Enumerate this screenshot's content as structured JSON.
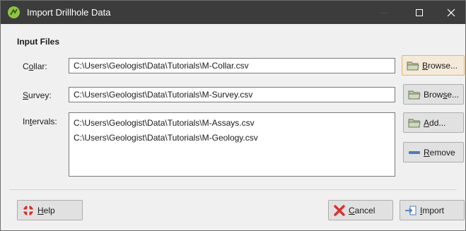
{
  "window": {
    "title": "Import Drillhole Data",
    "controls": {
      "minimize": "—",
      "maximize": "☐",
      "close": "✕"
    }
  },
  "input_files": {
    "section_label": "Input Files",
    "collar": {
      "label_pre": "C",
      "label_key": "o",
      "label_post": "llar:",
      "value": "C:\\Users\\Geologist\\Data\\Tutorials\\M-Collar.csv",
      "browse_pre": "",
      "browse_key": "B",
      "browse_post": "rowse..."
    },
    "survey": {
      "label_pre": "",
      "label_key": "S",
      "label_post": "urvey:",
      "value": "C:\\Users\\Geologist\\Data\\Tutorials\\M-Survey.csv",
      "browse_pre": "Brow",
      "browse_key": "s",
      "browse_post": "e..."
    },
    "intervals": {
      "label_pre": "In",
      "label_key": "t",
      "label_post": "ervals:",
      "items": [
        "C:\\Users\\Geologist\\Data\\Tutorials\\M-Assays.csv",
        "C:\\Users\\Geologist\\Data\\Tutorials\\M-Geology.csv"
      ],
      "add_pre": "",
      "add_key": "A",
      "add_post": "dd...",
      "remove_pre": "",
      "remove_key": "R",
      "remove_post": "emove"
    }
  },
  "footer": {
    "help_pre": "",
    "help_key": "H",
    "help_post": "elp",
    "cancel_pre": "",
    "cancel_key": "C",
    "cancel_post": "ancel",
    "import_pre": "",
    "import_key": "I",
    "import_post": "mport"
  },
  "icons": {
    "app": "leapfrog-app-icon",
    "folder": "folder-icon",
    "remove": "minus-bar-icon",
    "help": "lifebuoy-icon",
    "cancel": "red-x-icon",
    "import": "import-arrow-icon"
  },
  "colors": {
    "titlebar": "#3c3c3c",
    "app_icon": "#8ec63f",
    "focused_button_border": "#e8b46a",
    "cancel_red": "#d9302b",
    "remove_blue": "#4a7ebb"
  }
}
